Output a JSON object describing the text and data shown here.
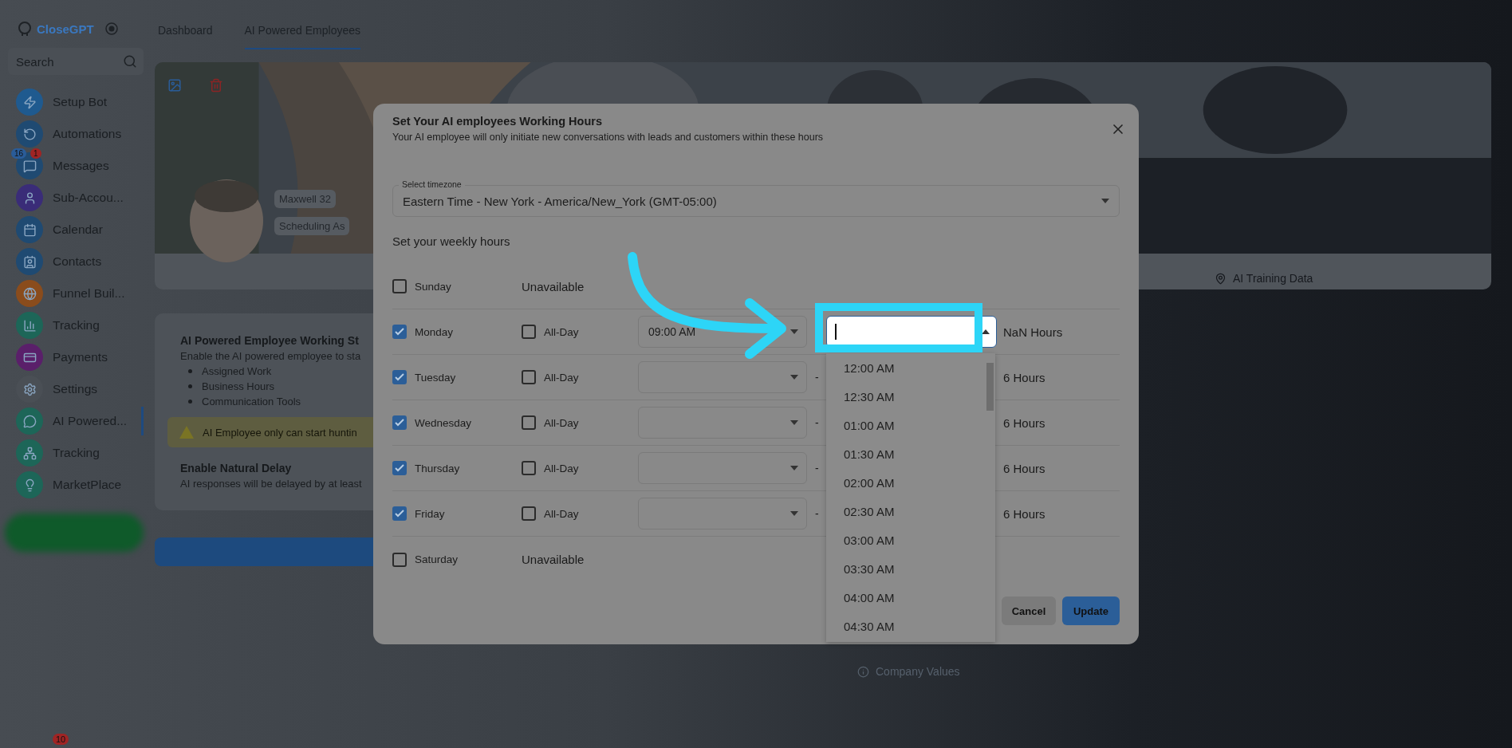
{
  "sidebar": {
    "logo": "CloseGPT",
    "search": {
      "placeholder": "Search"
    },
    "items": [
      {
        "label": "Setup Bot",
        "selected": false,
        "color": "#1f5a8f"
      },
      {
        "label": "Automations",
        "selected": false,
        "color": "#1f4a72"
      },
      {
        "label": "Messages",
        "selected": false,
        "color": "#1f4a72",
        "count": "16",
        "unread": "1"
      },
      {
        "label": "Sub-Accou...",
        "selected": false,
        "color": "#3a2c78"
      },
      {
        "label": "Calendar",
        "selected": false,
        "color": "#1f4a72"
      },
      {
        "label": "Contacts",
        "selected": false,
        "color": "#1f4a72"
      },
      {
        "label": "Funnel Buil...",
        "selected": false,
        "color": "#8a4c1c"
      },
      {
        "label": "Tracking",
        "selected": false,
        "color": "#1d6658"
      },
      {
        "label": "Payments",
        "selected": false,
        "color": "#5a1f6a"
      },
      {
        "label": "Settings",
        "selected": false,
        "color": "#4a4f55"
      },
      {
        "label": "AI Powered...",
        "selected": true,
        "color": "#1d6658"
      },
      {
        "label": "Tracking",
        "selected": false,
        "color": "#1d6658"
      },
      {
        "label": "MarketPlace",
        "selected": false,
        "color": "#1d6658"
      }
    ],
    "bottom_badge": "10"
  },
  "nav_tabs": [
    {
      "label": "Dashboard",
      "selected": false
    },
    {
      "label": "AI Powered Employees",
      "selected": true
    }
  ],
  "profile": {
    "name": "Maxwell 32",
    "role": "Scheduling As"
  },
  "working_card": {
    "title": "AI Powered Employee Working St",
    "description": "Enable the AI powered employee to sta",
    "bullets": [
      "Assigned Work",
      "Business Hours",
      "Communication Tools"
    ],
    "warning": "AI Employee only can start huntin",
    "delay_title": "Enable Natural Delay",
    "delay_text": "AI responses will be delayed by at least"
  },
  "side_tabs": [
    {
      "label": "AI Training Data"
    }
  ],
  "company_values": "Company Values",
  "dialog": {
    "title": "Set Your AI employees Working Hours",
    "subtitle": "Your AI employee will only initiate new conversations with leads and customers within these hours",
    "timezone": {
      "label": "Select timezone",
      "value": "Eastern Time - New York - America/New_York (GMT-05:00)"
    },
    "section_label": "Set your weekly hours",
    "days": [
      {
        "name": "Sunday",
        "checked": false,
        "status": "Unavailable"
      },
      {
        "name": "Monday",
        "checked": true,
        "all_day": false,
        "all_day_label": "All-Day",
        "start": "09:00 AM",
        "end_focused": true,
        "hours": "NaN Hours"
      },
      {
        "name": "Tuesday",
        "checked": true,
        "all_day": false,
        "all_day_label": "All-Day",
        "separator": "-",
        "end_focused": false,
        "hours": "6 Hours"
      },
      {
        "name": "Wednesday",
        "checked": true,
        "all_day": false,
        "all_day_label": "All-Day",
        "separator": "-",
        "end_focused": false,
        "hours": "6 Hours"
      },
      {
        "name": "Thursday",
        "checked": true,
        "all_day": false,
        "all_day_label": "All-Day",
        "separator": "-",
        "end_focused": false,
        "hours": "6 Hours"
      },
      {
        "name": "Friday",
        "checked": true,
        "all_day": false,
        "all_day_label": "All-Day",
        "separator": "-",
        "end_focused": false,
        "hours": "6 Hours"
      },
      {
        "name": "Saturday",
        "checked": false,
        "status": "Unavailable"
      }
    ],
    "time_options": [
      "12:00 AM",
      "12:30 AM",
      "01:00 AM",
      "01:30 AM",
      "02:00 AM",
      "02:30 AM",
      "03:00 AM",
      "03:30 AM",
      "04:00 AM",
      "04:30 AM"
    ],
    "cancel": "Cancel",
    "update": "Update"
  }
}
